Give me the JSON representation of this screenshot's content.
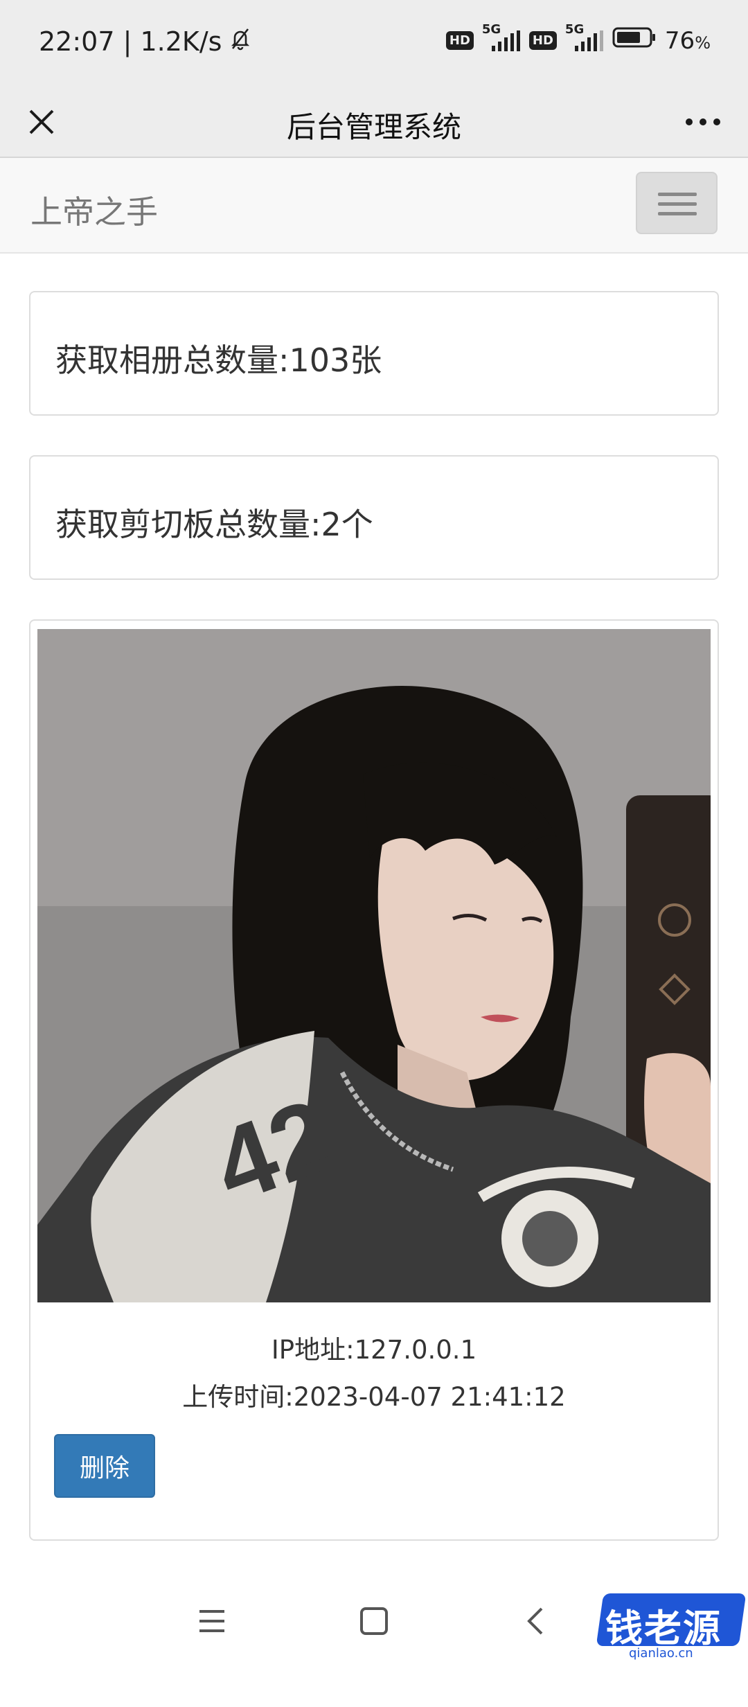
{
  "status_bar": {
    "time_speed": "22:07 | 1.2K/s",
    "hd_badge": "HD",
    "network": "5G",
    "battery": "76",
    "battery_unit": "%",
    "battery_level": 0.76
  },
  "title_bar": {
    "title": "后台管理系统"
  },
  "navbar": {
    "brand": "上帝之手"
  },
  "stats": {
    "album_count": "获取相册总数量:103张",
    "clipboard_count": "获取剪切板总数量:2个"
  },
  "photo_item": {
    "ip": "IP地址:127.0.0.1",
    "upload_time": "上传时间:2023-04-07 21:41:12",
    "delete_label": "删除"
  },
  "watermark": {
    "text": "钱老源码",
    "domain": "qianlao.cn"
  },
  "colors": {
    "primary_button": "#337ab7",
    "status_bg": "#ededed",
    "navbar_bg": "#f8f8f8"
  }
}
